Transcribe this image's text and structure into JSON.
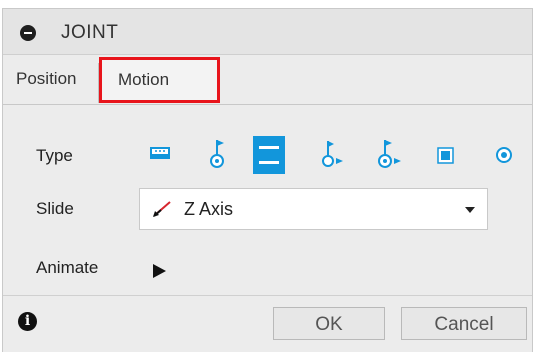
{
  "header": {
    "title": "JOINT"
  },
  "tabs": [
    {
      "label": "Position"
    },
    {
      "label": "Motion",
      "highlighted": true
    }
  ],
  "motion": {
    "type_label": "Type",
    "type_icons": [
      "rigid-joint-icon",
      "revolute-joint-icon",
      "slider-joint-icon",
      "cylindrical-joint-icon",
      "pin-slot-joint-icon",
      "planar-joint-icon",
      "ball-joint-icon"
    ],
    "selected_type": "slider-joint-icon",
    "slide_label": "Slide",
    "slide_value": "Z Axis",
    "animate_label": "Animate"
  },
  "footer": {
    "ok_label": "OK",
    "cancel_label": "Cancel"
  },
  "colors": {
    "accent": "#1296db",
    "highlight_outline": "#e8141b",
    "axis_red": "#d7262e"
  }
}
